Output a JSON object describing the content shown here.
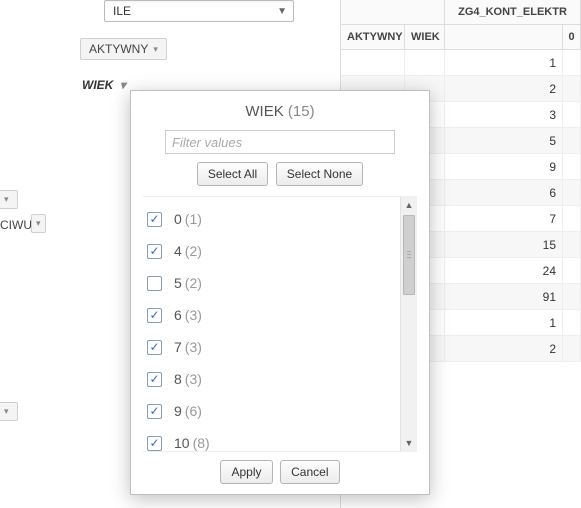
{
  "bg": {
    "dropdown_label": "ILE",
    "pills": {
      "aktywny": "AKTYWNY",
      "ciwu": "CIWU"
    },
    "active_field": "WIEK"
  },
  "grid": {
    "headers": {
      "group": "ZG4_KONT_ELEKTR",
      "col1": "AKTYWNY",
      "col2": "WIEK",
      "col3": "",
      "col4": "0"
    },
    "rows": [
      {
        "v": "1"
      },
      {
        "v": "2"
      },
      {
        "v": "3"
      },
      {
        "v": "5"
      },
      {
        "v": "9"
      },
      {
        "v": "6"
      },
      {
        "v": "7"
      },
      {
        "v": "15"
      },
      {
        "v": "24"
      },
      {
        "v": "91"
      },
      {
        "v": "1"
      },
      {
        "v": "2"
      }
    ]
  },
  "popup": {
    "title": "WIEK",
    "count": "(15)",
    "filter_placeholder": "Filter values",
    "select_all": "Select All",
    "select_none": "Select None",
    "items": [
      {
        "label": "0",
        "count": "(1)",
        "checked": true
      },
      {
        "label": "4",
        "count": "(2)",
        "checked": true
      },
      {
        "label": "5",
        "count": "(2)",
        "checked": false
      },
      {
        "label": "6",
        "count": "(3)",
        "checked": true
      },
      {
        "label": "7",
        "count": "(3)",
        "checked": true
      },
      {
        "label": "8",
        "count": "(3)",
        "checked": true
      },
      {
        "label": "9",
        "count": "(6)",
        "checked": true
      },
      {
        "label": "10",
        "count": "(8)",
        "checked": true
      }
    ],
    "apply": "Apply",
    "cancel": "Cancel"
  }
}
